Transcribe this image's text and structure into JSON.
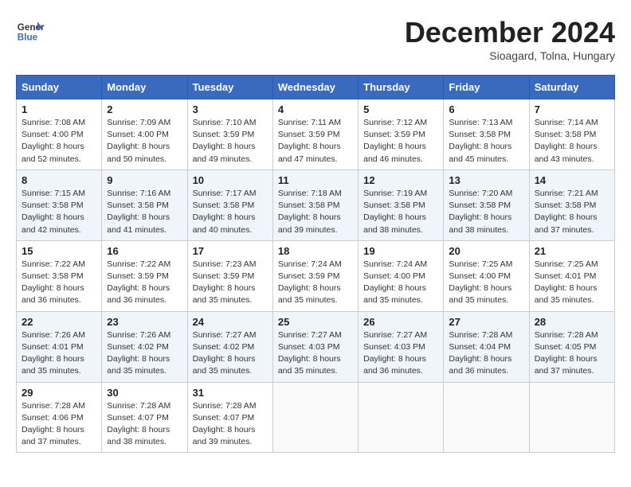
{
  "header": {
    "logo_line1": "General",
    "logo_line2": "Blue",
    "month": "December 2024",
    "location": "Sioagard, Tolna, Hungary"
  },
  "weekdays": [
    "Sunday",
    "Monday",
    "Tuesday",
    "Wednesday",
    "Thursday",
    "Friday",
    "Saturday"
  ],
  "weeks": [
    [
      {
        "day": "1",
        "sunrise": "Sunrise: 7:08 AM",
        "sunset": "Sunset: 4:00 PM",
        "daylight": "Daylight: 8 hours and 52 minutes."
      },
      {
        "day": "2",
        "sunrise": "Sunrise: 7:09 AM",
        "sunset": "Sunset: 4:00 PM",
        "daylight": "Daylight: 8 hours and 50 minutes."
      },
      {
        "day": "3",
        "sunrise": "Sunrise: 7:10 AM",
        "sunset": "Sunset: 3:59 PM",
        "daylight": "Daylight: 8 hours and 49 minutes."
      },
      {
        "day": "4",
        "sunrise": "Sunrise: 7:11 AM",
        "sunset": "Sunset: 3:59 PM",
        "daylight": "Daylight: 8 hours and 47 minutes."
      },
      {
        "day": "5",
        "sunrise": "Sunrise: 7:12 AM",
        "sunset": "Sunset: 3:59 PM",
        "daylight": "Daylight: 8 hours and 46 minutes."
      },
      {
        "day": "6",
        "sunrise": "Sunrise: 7:13 AM",
        "sunset": "Sunset: 3:58 PM",
        "daylight": "Daylight: 8 hours and 45 minutes."
      },
      {
        "day": "7",
        "sunrise": "Sunrise: 7:14 AM",
        "sunset": "Sunset: 3:58 PM",
        "daylight": "Daylight: 8 hours and 43 minutes."
      }
    ],
    [
      {
        "day": "8",
        "sunrise": "Sunrise: 7:15 AM",
        "sunset": "Sunset: 3:58 PM",
        "daylight": "Daylight: 8 hours and 42 minutes."
      },
      {
        "day": "9",
        "sunrise": "Sunrise: 7:16 AM",
        "sunset": "Sunset: 3:58 PM",
        "daylight": "Daylight: 8 hours and 41 minutes."
      },
      {
        "day": "10",
        "sunrise": "Sunrise: 7:17 AM",
        "sunset": "Sunset: 3:58 PM",
        "daylight": "Daylight: 8 hours and 40 minutes."
      },
      {
        "day": "11",
        "sunrise": "Sunrise: 7:18 AM",
        "sunset": "Sunset: 3:58 PM",
        "daylight": "Daylight: 8 hours and 39 minutes."
      },
      {
        "day": "12",
        "sunrise": "Sunrise: 7:19 AM",
        "sunset": "Sunset: 3:58 PM",
        "daylight": "Daylight: 8 hours and 38 minutes."
      },
      {
        "day": "13",
        "sunrise": "Sunrise: 7:20 AM",
        "sunset": "Sunset: 3:58 PM",
        "daylight": "Daylight: 8 hours and 38 minutes."
      },
      {
        "day": "14",
        "sunrise": "Sunrise: 7:21 AM",
        "sunset": "Sunset: 3:58 PM",
        "daylight": "Daylight: 8 hours and 37 minutes."
      }
    ],
    [
      {
        "day": "15",
        "sunrise": "Sunrise: 7:22 AM",
        "sunset": "Sunset: 3:58 PM",
        "daylight": "Daylight: 8 hours and 36 minutes."
      },
      {
        "day": "16",
        "sunrise": "Sunrise: 7:22 AM",
        "sunset": "Sunset: 3:59 PM",
        "daylight": "Daylight: 8 hours and 36 minutes."
      },
      {
        "day": "17",
        "sunrise": "Sunrise: 7:23 AM",
        "sunset": "Sunset: 3:59 PM",
        "daylight": "Daylight: 8 hours and 35 minutes."
      },
      {
        "day": "18",
        "sunrise": "Sunrise: 7:24 AM",
        "sunset": "Sunset: 3:59 PM",
        "daylight": "Daylight: 8 hours and 35 minutes."
      },
      {
        "day": "19",
        "sunrise": "Sunrise: 7:24 AM",
        "sunset": "Sunset: 4:00 PM",
        "daylight": "Daylight: 8 hours and 35 minutes."
      },
      {
        "day": "20",
        "sunrise": "Sunrise: 7:25 AM",
        "sunset": "Sunset: 4:00 PM",
        "daylight": "Daylight: 8 hours and 35 minutes."
      },
      {
        "day": "21",
        "sunrise": "Sunrise: 7:25 AM",
        "sunset": "Sunset: 4:01 PM",
        "daylight": "Daylight: 8 hours and 35 minutes."
      }
    ],
    [
      {
        "day": "22",
        "sunrise": "Sunrise: 7:26 AM",
        "sunset": "Sunset: 4:01 PM",
        "daylight": "Daylight: 8 hours and 35 minutes."
      },
      {
        "day": "23",
        "sunrise": "Sunrise: 7:26 AM",
        "sunset": "Sunset: 4:02 PM",
        "daylight": "Daylight: 8 hours and 35 minutes."
      },
      {
        "day": "24",
        "sunrise": "Sunrise: 7:27 AM",
        "sunset": "Sunset: 4:02 PM",
        "daylight": "Daylight: 8 hours and 35 minutes."
      },
      {
        "day": "25",
        "sunrise": "Sunrise: 7:27 AM",
        "sunset": "Sunset: 4:03 PM",
        "daylight": "Daylight: 8 hours and 35 minutes."
      },
      {
        "day": "26",
        "sunrise": "Sunrise: 7:27 AM",
        "sunset": "Sunset: 4:03 PM",
        "daylight": "Daylight: 8 hours and 36 minutes."
      },
      {
        "day": "27",
        "sunrise": "Sunrise: 7:28 AM",
        "sunset": "Sunset: 4:04 PM",
        "daylight": "Daylight: 8 hours and 36 minutes."
      },
      {
        "day": "28",
        "sunrise": "Sunrise: 7:28 AM",
        "sunset": "Sunset: 4:05 PM",
        "daylight": "Daylight: 8 hours and 37 minutes."
      }
    ],
    [
      {
        "day": "29",
        "sunrise": "Sunrise: 7:28 AM",
        "sunset": "Sunset: 4:06 PM",
        "daylight": "Daylight: 8 hours and 37 minutes."
      },
      {
        "day": "30",
        "sunrise": "Sunrise: 7:28 AM",
        "sunset": "Sunset: 4:07 PM",
        "daylight": "Daylight: 8 hours and 38 minutes."
      },
      {
        "day": "31",
        "sunrise": "Sunrise: 7:28 AM",
        "sunset": "Sunset: 4:07 PM",
        "daylight": "Daylight: 8 hours and 39 minutes."
      },
      null,
      null,
      null,
      null
    ]
  ]
}
